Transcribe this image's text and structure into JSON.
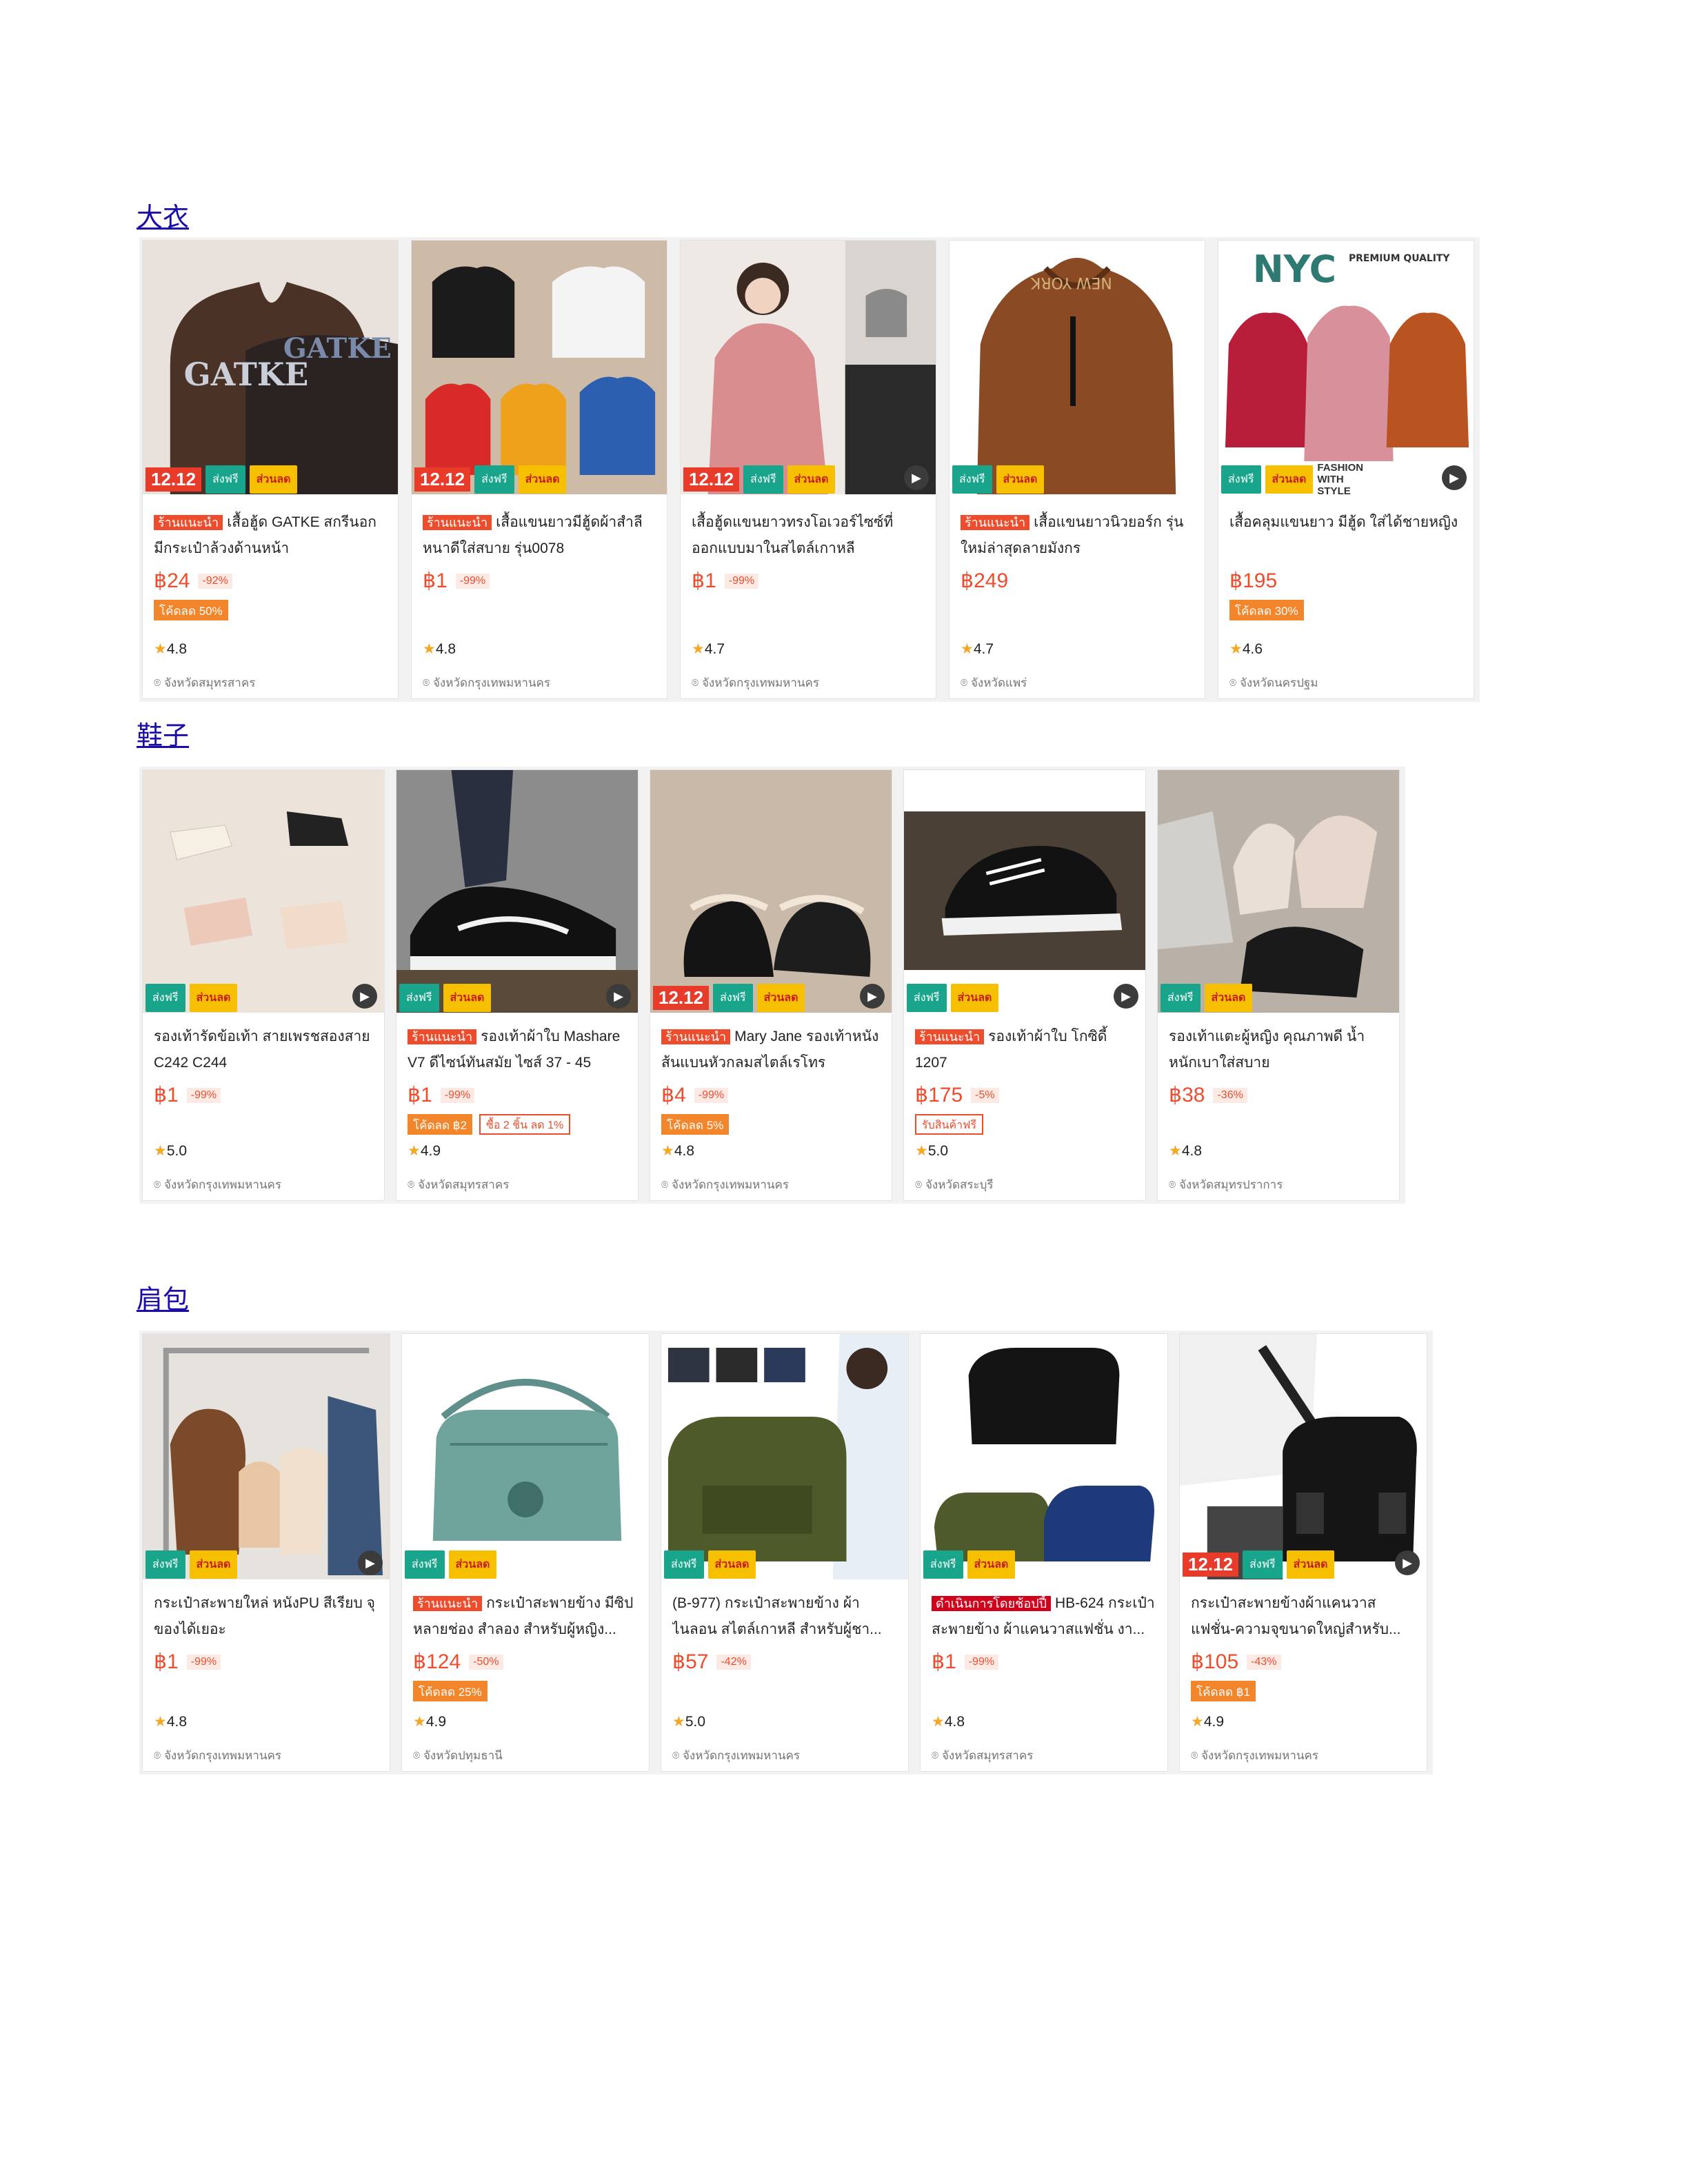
{
  "sections": [
    {
      "label": "大衣"
    },
    {
      "label": "鞋子"
    },
    {
      "label": "肩包"
    }
  ],
  "badges": {
    "event": "12.12",
    "free_shipping": "ส่งฟรี",
    "discount": "ส่วนลด",
    "shop_recommended": "ร้านแนะนำ",
    "mall_seller": "ดำเนินการโดยช้อปปี้"
  },
  "products": {
    "coats": [
      {
        "tag": "ร้านแนะนำ",
        "title": "เสื้อฮู้ด GATKE สกรีนอก มีกระเป๋าล้วงด้านหน้า",
        "price": "฿24",
        "discount": "-92%",
        "promo": "โค้ดลด 50%",
        "rating": "4.8",
        "location": "จังหวัดสมุทรสาคร"
      },
      {
        "tag": "ร้านแนะนำ",
        "title": "เสื้อแขนยาวมีฮู้ดผ้าสำลีหนาดีใส่สบาย รุ่น0078",
        "price": "฿1",
        "discount": "-99%",
        "promo": "",
        "rating": "4.8",
        "location": "จังหวัดกรุงเทพมหานคร"
      },
      {
        "tag": "",
        "title": "เสื้อฮู้ดแขนยาวทรงโอเวอร์ไซซ์ที่ออกแบบมาในสไตล์เกาหลี",
        "price": "฿1",
        "discount": "-99%",
        "promo": "",
        "rating": "4.7",
        "location": "จังหวัดกรุงเทพมหานคร"
      },
      {
        "tag": "ร้านแนะนำ",
        "title": "เสื้อแขนยาวนิวยอร์ก รุ่นใหม่ล่าสุดลายมังกร",
        "price": "฿249",
        "discount": "",
        "promo": "",
        "rating": "4.7",
        "location": "จังหวัดแพร่"
      },
      {
        "tag": "",
        "title": "เสื้อคลุมแขนยาว มีฮู้ด ใส่ได้ชายหญิง",
        "price": "฿195",
        "discount": "",
        "promo": "โค้ดลด 30%",
        "rating": "4.6",
        "location": "จังหวัดนครปฐม"
      }
    ],
    "shoes": [
      {
        "tag": "",
        "title": "รองเท้ารัดข้อเท้า สายเพรชสองสาย C242 C244",
        "price": "฿1",
        "discount": "-99%",
        "promo": "",
        "promo2": "",
        "rating": "5.0",
        "location": "จังหวัดกรุงเทพมหานคร"
      },
      {
        "tag": "ร้านแนะนำ",
        "title": "รองเท้าผ้าใบ Mashare V7 ดีไซน์ทันสมัย ไซส์ 37 - 45",
        "price": "฿1",
        "discount": "-99%",
        "promo": "โค้ดลด ฿2",
        "promo2": "ซื้อ 2 ชิ้น ลด 1%",
        "rating": "4.9",
        "location": "จังหวัดสมุทรสาคร"
      },
      {
        "tag": "ร้านแนะนำ",
        "title": "Mary Jane รองเท้าหนังส้นแบนหัวกลมสไตล์เรโทร",
        "price": "฿4",
        "discount": "-99%",
        "promo": "โค้ดลด 5%",
        "promo2": "",
        "rating": "4.8",
        "location": "จังหวัดกรุงเทพมหานคร"
      },
      {
        "tag": "ร้านแนะนำ",
        "title": "รองเท้าผ้าใบ โกซิดี้ 1207",
        "price": "฿175",
        "discount": "-5%",
        "promo": "",
        "promo2": "รับสินค้าฟรี",
        "rating": "5.0",
        "location": "จังหวัดสระบุรี"
      },
      {
        "tag": "",
        "title": "รองเท้าแตะผู้หญิง คุณภาพดี น้ำหนักเบาใส่สบาย",
        "price": "฿38",
        "discount": "-36%",
        "promo": "",
        "promo2": "",
        "rating": "4.8",
        "location": "จังหวัดสมุทรปราการ"
      }
    ],
    "bags": [
      {
        "tag": "",
        "title": "กระเป๋าสะพายใหล่ หนังPU สีเรียบ จุของได้เยอะ",
        "price": "฿1",
        "discount": "-99%",
        "promo": "",
        "rating": "4.8",
        "location": "จังหวัดกรุงเทพมหานคร"
      },
      {
        "tag": "ร้านแนะนำ",
        "title": "กระเป๋าสะพายข้าง มีซิปหลายช่อง สำลอง สำหรับผู้หญิง...",
        "price": "฿124",
        "discount": "-50%",
        "promo": "โค้ดลด 25%",
        "rating": "4.9",
        "location": "จังหวัดปทุมธานี"
      },
      {
        "tag": "",
        "title": "(B-977) กระเป๋าสะพายข้าง ผ้าไนลอน สไตล์เกาหลี สำหรับผู้ชา...",
        "price": "฿57",
        "discount": "-42%",
        "promo": "",
        "rating": "5.0",
        "location": "จังหวัดกรุงเทพมหานคร"
      },
      {
        "tag": "ดำเนินการโดยช้อปปี้",
        "title": "HB-624 กระเป๋าสะพายข้าง ผ้าแคนวาสแฟชั่น งา...",
        "price": "฿1",
        "discount": "-99%",
        "promo": "",
        "rating": "4.8",
        "location": "จังหวัดสมุทรสาคร"
      },
      {
        "tag": "",
        "title": "กระเป๋าสะพายข้างผ้าแคนวาสแฟชั่น-ความจุขนาดใหญ่สำหรับ...",
        "price": "฿105",
        "discount": "-43%",
        "promo": "โค้ดลด ฿1",
        "rating": "4.9",
        "location": "จังหวัดกรุงเทพมหานคร"
      }
    ]
  },
  "image_text": {
    "gatke": "GATKE",
    "nyc": "NYC",
    "nyc_premium": "PREMIUM QUALITY",
    "fashion_style": "FASHION WITH STYLE",
    "newyork": "NEW YORK"
  },
  "icons": {
    "star": "star-icon",
    "location": "location-pin-icon",
    "play": "play-icon",
    "truck": "truck-icon"
  }
}
